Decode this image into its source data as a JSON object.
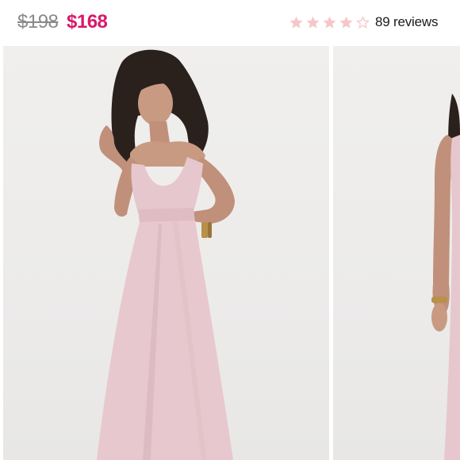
{
  "product": {
    "original_price": "$198",
    "sale_price": "$168",
    "rating": 4,
    "rating_max": 5,
    "reviews_label": "89 reviews",
    "colors": {
      "sale_price": "#d8196c",
      "star_filled": "#f7c6c8",
      "star_empty": "#f7c6c8"
    }
  },
  "gallery": {
    "images": [
      {
        "alt": "model-front-view"
      },
      {
        "alt": "model-side-view"
      }
    ]
  }
}
